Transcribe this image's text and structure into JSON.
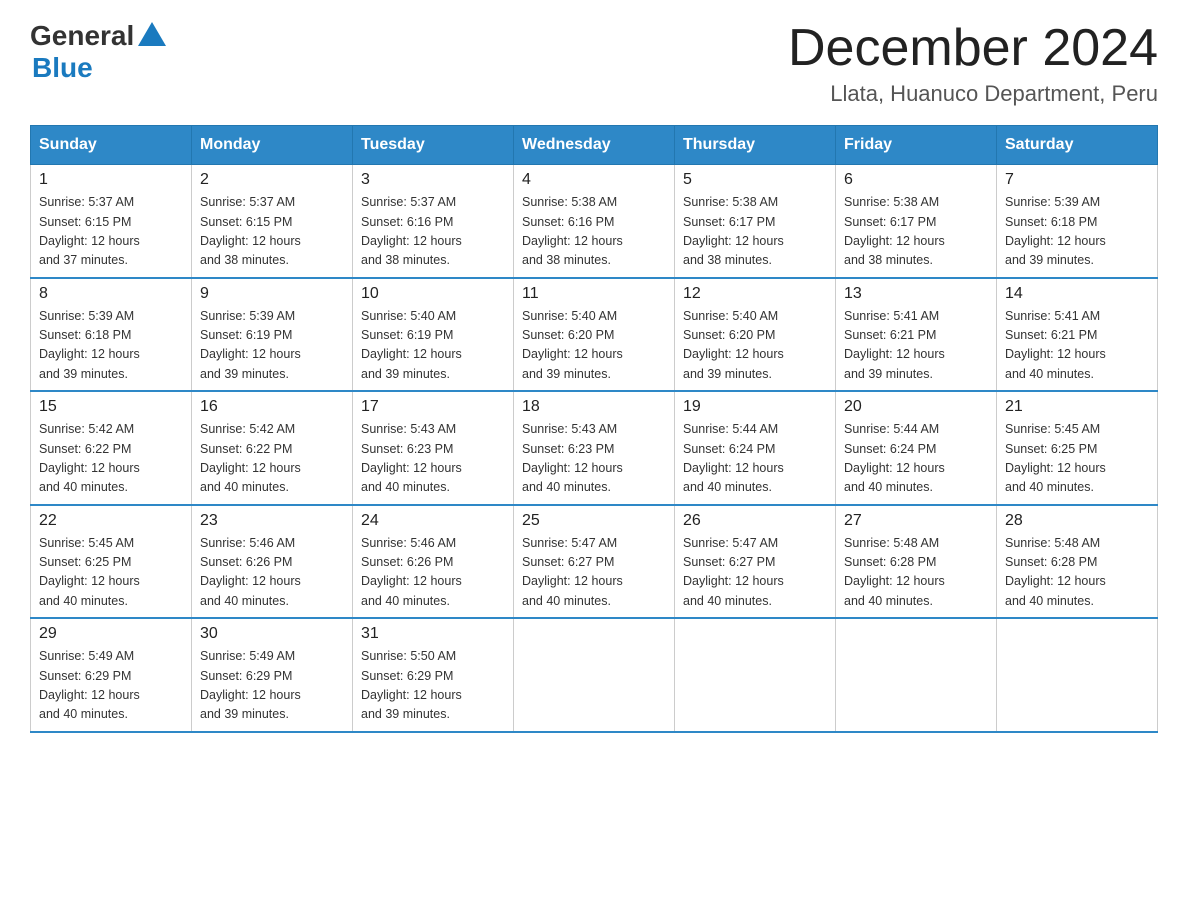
{
  "header": {
    "logo_general": "General",
    "logo_blue": "Blue",
    "month_title": "December 2024",
    "location": "Llata, Huanuco Department, Peru"
  },
  "weekdays": [
    "Sunday",
    "Monday",
    "Tuesday",
    "Wednesday",
    "Thursday",
    "Friday",
    "Saturday"
  ],
  "weeks": [
    [
      {
        "day": "1",
        "sunrise": "5:37 AM",
        "sunset": "6:15 PM",
        "daylight": "12 hours and 37 minutes."
      },
      {
        "day": "2",
        "sunrise": "5:37 AM",
        "sunset": "6:15 PM",
        "daylight": "12 hours and 38 minutes."
      },
      {
        "day": "3",
        "sunrise": "5:37 AM",
        "sunset": "6:16 PM",
        "daylight": "12 hours and 38 minutes."
      },
      {
        "day": "4",
        "sunrise": "5:38 AM",
        "sunset": "6:16 PM",
        "daylight": "12 hours and 38 minutes."
      },
      {
        "day": "5",
        "sunrise": "5:38 AM",
        "sunset": "6:17 PM",
        "daylight": "12 hours and 38 minutes."
      },
      {
        "day": "6",
        "sunrise": "5:38 AM",
        "sunset": "6:17 PM",
        "daylight": "12 hours and 38 minutes."
      },
      {
        "day": "7",
        "sunrise": "5:39 AM",
        "sunset": "6:18 PM",
        "daylight": "12 hours and 39 minutes."
      }
    ],
    [
      {
        "day": "8",
        "sunrise": "5:39 AM",
        "sunset": "6:18 PM",
        "daylight": "12 hours and 39 minutes."
      },
      {
        "day": "9",
        "sunrise": "5:39 AM",
        "sunset": "6:19 PM",
        "daylight": "12 hours and 39 minutes."
      },
      {
        "day": "10",
        "sunrise": "5:40 AM",
        "sunset": "6:19 PM",
        "daylight": "12 hours and 39 minutes."
      },
      {
        "day": "11",
        "sunrise": "5:40 AM",
        "sunset": "6:20 PM",
        "daylight": "12 hours and 39 minutes."
      },
      {
        "day": "12",
        "sunrise": "5:40 AM",
        "sunset": "6:20 PM",
        "daylight": "12 hours and 39 minutes."
      },
      {
        "day": "13",
        "sunrise": "5:41 AM",
        "sunset": "6:21 PM",
        "daylight": "12 hours and 39 minutes."
      },
      {
        "day": "14",
        "sunrise": "5:41 AM",
        "sunset": "6:21 PM",
        "daylight": "12 hours and 40 minutes."
      }
    ],
    [
      {
        "day": "15",
        "sunrise": "5:42 AM",
        "sunset": "6:22 PM",
        "daylight": "12 hours and 40 minutes."
      },
      {
        "day": "16",
        "sunrise": "5:42 AM",
        "sunset": "6:22 PM",
        "daylight": "12 hours and 40 minutes."
      },
      {
        "day": "17",
        "sunrise": "5:43 AM",
        "sunset": "6:23 PM",
        "daylight": "12 hours and 40 minutes."
      },
      {
        "day": "18",
        "sunrise": "5:43 AM",
        "sunset": "6:23 PM",
        "daylight": "12 hours and 40 minutes."
      },
      {
        "day": "19",
        "sunrise": "5:44 AM",
        "sunset": "6:24 PM",
        "daylight": "12 hours and 40 minutes."
      },
      {
        "day": "20",
        "sunrise": "5:44 AM",
        "sunset": "6:24 PM",
        "daylight": "12 hours and 40 minutes."
      },
      {
        "day": "21",
        "sunrise": "5:45 AM",
        "sunset": "6:25 PM",
        "daylight": "12 hours and 40 minutes."
      }
    ],
    [
      {
        "day": "22",
        "sunrise": "5:45 AM",
        "sunset": "6:25 PM",
        "daylight": "12 hours and 40 minutes."
      },
      {
        "day": "23",
        "sunrise": "5:46 AM",
        "sunset": "6:26 PM",
        "daylight": "12 hours and 40 minutes."
      },
      {
        "day": "24",
        "sunrise": "5:46 AM",
        "sunset": "6:26 PM",
        "daylight": "12 hours and 40 minutes."
      },
      {
        "day": "25",
        "sunrise": "5:47 AM",
        "sunset": "6:27 PM",
        "daylight": "12 hours and 40 minutes."
      },
      {
        "day": "26",
        "sunrise": "5:47 AM",
        "sunset": "6:27 PM",
        "daylight": "12 hours and 40 minutes."
      },
      {
        "day": "27",
        "sunrise": "5:48 AM",
        "sunset": "6:28 PM",
        "daylight": "12 hours and 40 minutes."
      },
      {
        "day": "28",
        "sunrise": "5:48 AM",
        "sunset": "6:28 PM",
        "daylight": "12 hours and 40 minutes."
      }
    ],
    [
      {
        "day": "29",
        "sunrise": "5:49 AM",
        "sunset": "6:29 PM",
        "daylight": "12 hours and 40 minutes."
      },
      {
        "day": "30",
        "sunrise": "5:49 AM",
        "sunset": "6:29 PM",
        "daylight": "12 hours and 39 minutes."
      },
      {
        "day": "31",
        "sunrise": "5:50 AM",
        "sunset": "6:29 PM",
        "daylight": "12 hours and 39 minutes."
      },
      null,
      null,
      null,
      null
    ]
  ],
  "labels": {
    "sunrise": "Sunrise:",
    "sunset": "Sunset:",
    "daylight": "Daylight: 12 hours"
  }
}
